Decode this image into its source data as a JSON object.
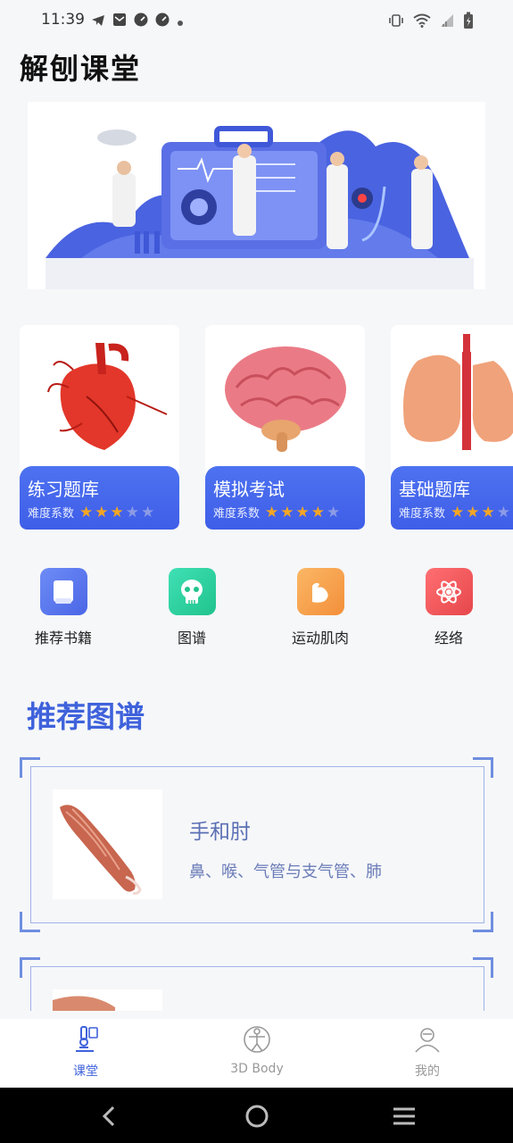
{
  "status_bar": {
    "time": "11:39"
  },
  "app": {
    "title": "解刨课堂"
  },
  "cards": [
    {
      "title": "练习题库",
      "difficulty_label": "难度系数",
      "stars": 3,
      "max_stars": 5,
      "image": "heart"
    },
    {
      "title": "模拟考试",
      "difficulty_label": "难度系数",
      "stars": 4,
      "max_stars": 5,
      "image": "brain"
    },
    {
      "title": "基础题库",
      "difficulty_label": "难度系数",
      "stars": 3,
      "max_stars": 5,
      "image": "lungs"
    }
  ],
  "quick_links": [
    {
      "label": "推荐书籍",
      "icon": "book-icon",
      "color": "#5a7cf0"
    },
    {
      "label": "图谱",
      "icon": "skull-icon",
      "color": "#2fd3a0"
    },
    {
      "label": "运动肌肉",
      "icon": "muscle-arm-icon",
      "color": "#f7a04a"
    },
    {
      "label": "经络",
      "icon": "atom-icon",
      "color": "#f2575b"
    }
  ],
  "recommended": {
    "title": "推荐图谱",
    "items": [
      {
        "title": "手和肘",
        "desc": "鼻、喉、气管与支气管、肺"
      }
    ]
  },
  "bottom_nav": [
    {
      "label": "课堂",
      "icon": "microscope-icon",
      "active": true
    },
    {
      "label": "3D Body",
      "icon": "body-icon",
      "active": false
    },
    {
      "label": "我的",
      "icon": "doctor-avatar-icon",
      "active": false
    }
  ],
  "colors": {
    "accent": "#3f62db",
    "card_bottom": "#4d72f0",
    "star": "#f5a623"
  }
}
